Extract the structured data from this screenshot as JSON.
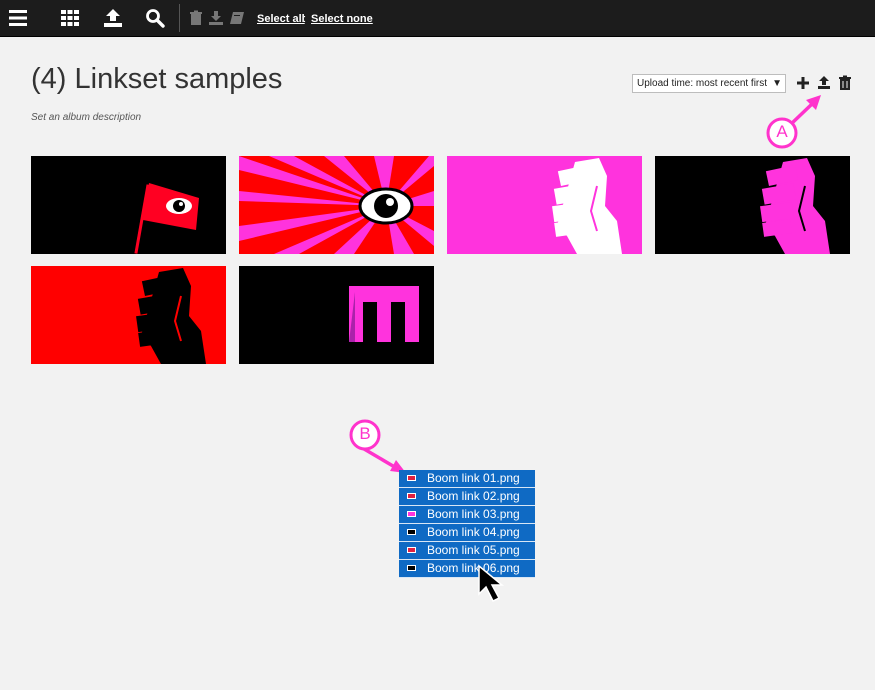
{
  "toolbar": {
    "select_all": "Select all",
    "separator": ":",
    "select_none": "Select none"
  },
  "album": {
    "title": "(4) Linkset samples",
    "description": "Set an album description"
  },
  "sort": {
    "selected": "Upload time: most recent first",
    "arrow": "▼"
  },
  "thumbnails": [
    {
      "name": "flag-eye",
      "bg": "#000000"
    },
    {
      "name": "burst-eye",
      "bg": "#ff0000"
    },
    {
      "name": "fist-pink",
      "bg": "#ff33dd"
    },
    {
      "name": "fist-black",
      "bg": "#000000"
    },
    {
      "name": "fist-red",
      "bg": "#ff0000"
    },
    {
      "name": "letter-m",
      "bg": "#000000"
    }
  ],
  "annotations": {
    "a": "A",
    "b": "B"
  },
  "files": [
    {
      "name": "Boom link 01.png",
      "icon_color": "#e02040"
    },
    {
      "name": "Boom link 02.png",
      "icon_color": "#e02040"
    },
    {
      "name": "Boom link 03.png",
      "icon_color": "#ff33dd"
    },
    {
      "name": "Boom link 04.png",
      "icon_color": "#000000"
    },
    {
      "name": "Boom link 05.png",
      "icon_color": "#e02040"
    },
    {
      "name": "Boom link 06.png",
      "icon_color": "#000000"
    }
  ],
  "colors": {
    "accent": "#ff33cc",
    "topbar": "#1c1c1c",
    "selection": "#0f6ac4"
  }
}
